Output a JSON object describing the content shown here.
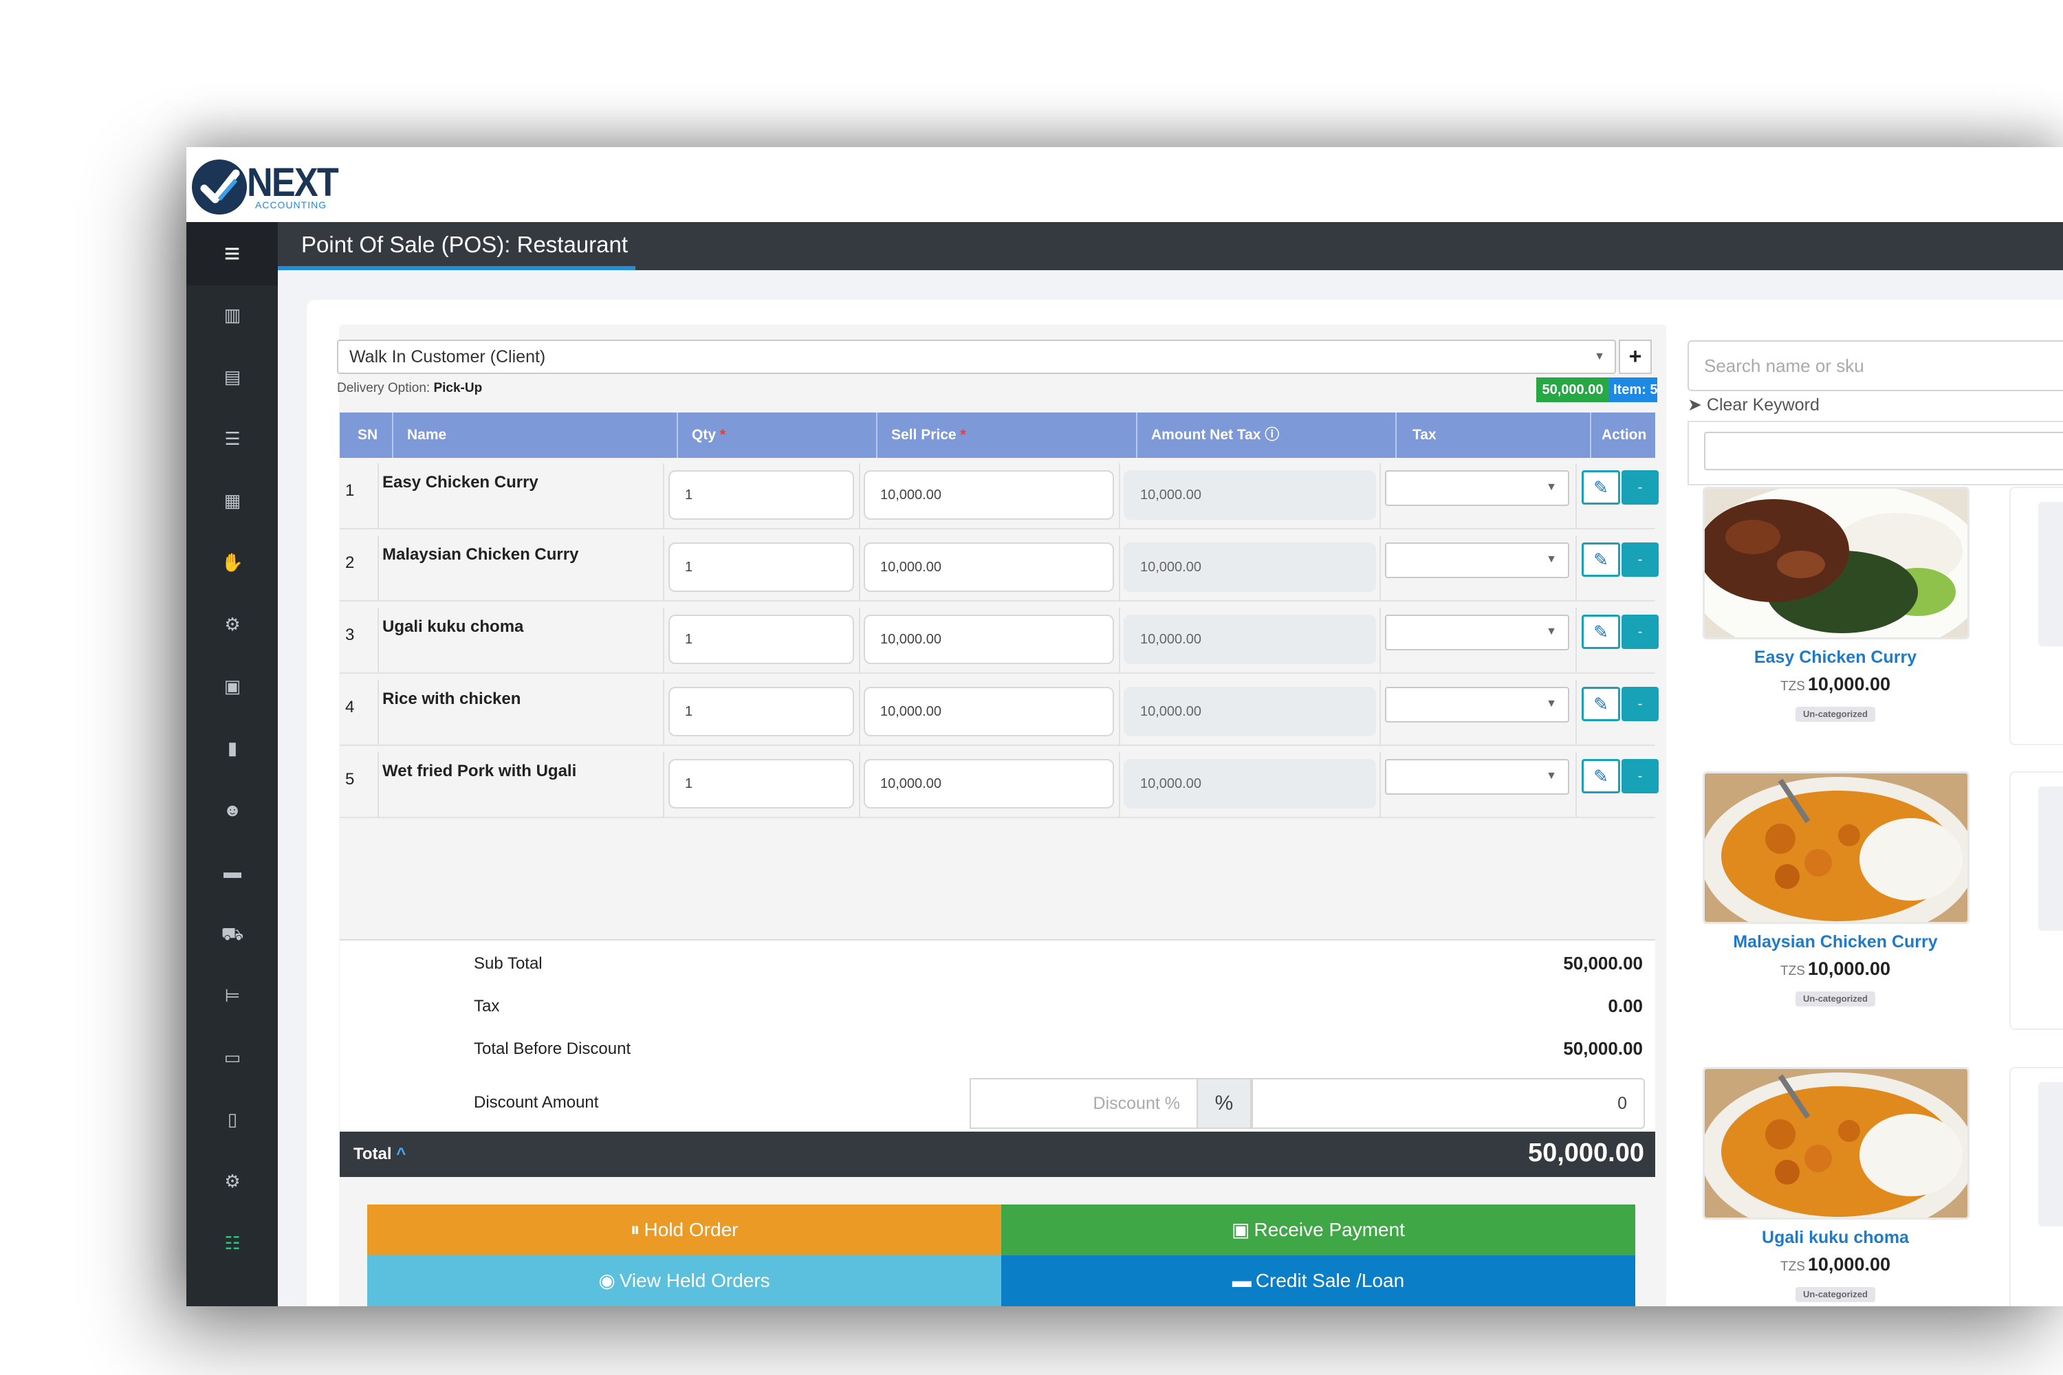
{
  "brand": {
    "name": "NEXT",
    "tagline": "ACCOUNTING"
  },
  "sidebar": {
    "menu_icon": "hamburger-icon",
    "icons": [
      "chart-bar-icon",
      "credit-card-icon",
      "list-icon",
      "calculator-icon",
      "handshake-icon",
      "users-cog-icon",
      "boxes-icon",
      "clipboard-icon",
      "users-icon",
      "money-bill-icon",
      "truck-icon",
      "bed-icon",
      "card-icon",
      "file-icon",
      "cogs-icon",
      "sliders-icon"
    ]
  },
  "header": {
    "title": "Point Of Sale (POS): Restaurant"
  },
  "customer": {
    "selected": "Walk In Customer (Client)",
    "add_label": "+"
  },
  "delivery": {
    "label": "Delivery Option:",
    "value": "Pick-Up"
  },
  "badges": {
    "total": "50,000.00",
    "items": "Item: 5"
  },
  "table": {
    "headers": {
      "sn": "SN",
      "name": "Name",
      "qty": "Qty",
      "sell_price": "Sell Price",
      "amount_net_tax": "Amount Net Tax",
      "tax": "Tax",
      "action": "Action"
    },
    "required_mark": "*",
    "rows": [
      {
        "sn": "1",
        "name": "Easy Chicken Curry",
        "qty": "1",
        "price": "10,000.00",
        "amount": "10,000.00"
      },
      {
        "sn": "2",
        "name": "Malaysian Chicken Curry",
        "qty": "1",
        "price": "10,000.00",
        "amount": "10,000.00"
      },
      {
        "sn": "3",
        "name": "Ugali kuku choma",
        "qty": "1",
        "price": "10,000.00",
        "amount": "10,000.00"
      },
      {
        "sn": "4",
        "name": "Rice with chicken",
        "qty": "1",
        "price": "10,000.00",
        "amount": "10,000.00"
      },
      {
        "sn": "5",
        "name": "Wet fried Pork with Ugali",
        "qty": "1",
        "price": "10,000.00",
        "amount": "10,000.00"
      }
    ]
  },
  "totals": {
    "subtotal_label": "Sub Total",
    "subtotal": "50,000.00",
    "tax_label": "Tax",
    "tax": "0.00",
    "before_discount_label": "Total Before Discount",
    "before_discount": "50,000.00",
    "discount_label": "Discount Amount",
    "discount_placeholder": "Discount %",
    "discount_pct_symbol": "%",
    "discount_amount": "0",
    "total_label": "Total",
    "total": "50,000.00"
  },
  "buttons": {
    "hold": "Hold Order",
    "receive": "Receive Payment",
    "view_held": "View Held Orders",
    "credit": "Credit Sale /Loan",
    "hold_color": "#ec9a26",
    "receive_color": "#3fa745",
    "view_color": "#5bc0de",
    "credit_color": "#0a7fc7"
  },
  "products": {
    "search_placeholder": "Search name or sku",
    "clear_label": "Clear Keyword",
    "currency": "TZS",
    "items": [
      {
        "name": "Easy Chicken Curry",
        "price": "10,000.00",
        "category": "Un-categorized"
      },
      {
        "name": "Malaysian Chicken Curry",
        "price": "10,000.00",
        "category": "Un-categorized"
      },
      {
        "name": "Ugali kuku choma",
        "price": "10,000.00",
        "category": "Un-categorized"
      }
    ]
  }
}
